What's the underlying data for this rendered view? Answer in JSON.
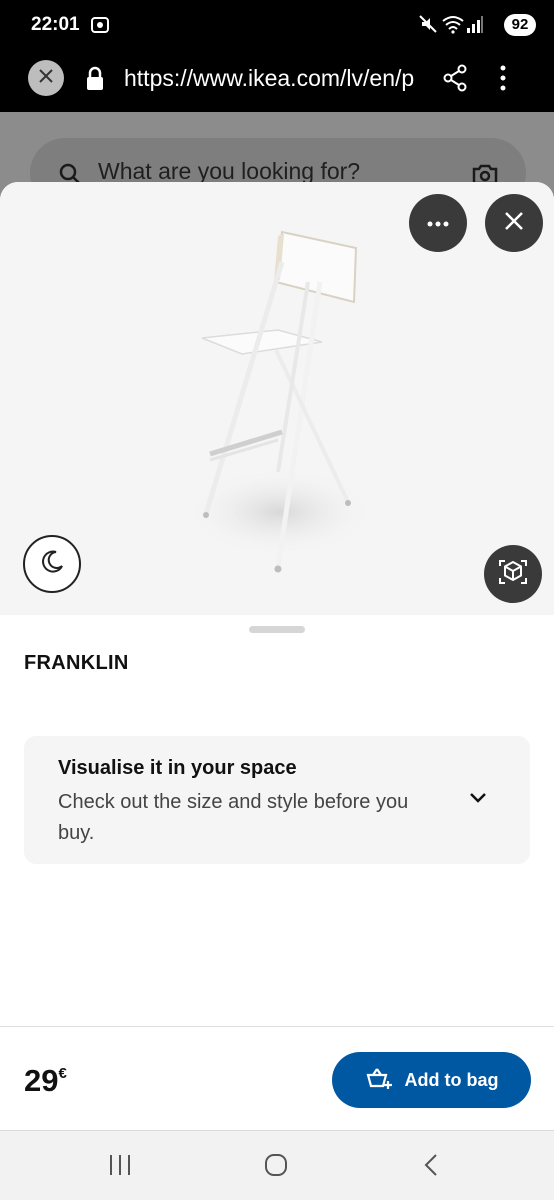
{
  "status_bar": {
    "time": "22:01",
    "battery": "92"
  },
  "browser": {
    "url": "https://www.ikea.com/lv/en/p"
  },
  "page": {
    "search_placeholder": "What are you looking for?"
  },
  "product": {
    "name": "FRANKLIN",
    "price_value": "29",
    "price_currency": "€"
  },
  "visualise": {
    "title": "Visualise it in your space",
    "description": "Check out the size and style before you buy."
  },
  "actions": {
    "add_to_bag": "Add to bag"
  },
  "colors": {
    "ikea_blue": "#0058a3",
    "dark_button": "#3a3a3a"
  },
  "icons": [
    "screen-record-icon",
    "mute-icon",
    "wifi-icon",
    "signal-icon",
    "close-icon",
    "lock-icon",
    "share-icon",
    "more-vert-icon",
    "search-icon",
    "camera-icon",
    "more-horiz-icon",
    "moon-icon",
    "ar-cube-icon",
    "chevron-down-icon",
    "bag-add-icon",
    "recents-icon",
    "home-icon",
    "back-icon"
  ]
}
